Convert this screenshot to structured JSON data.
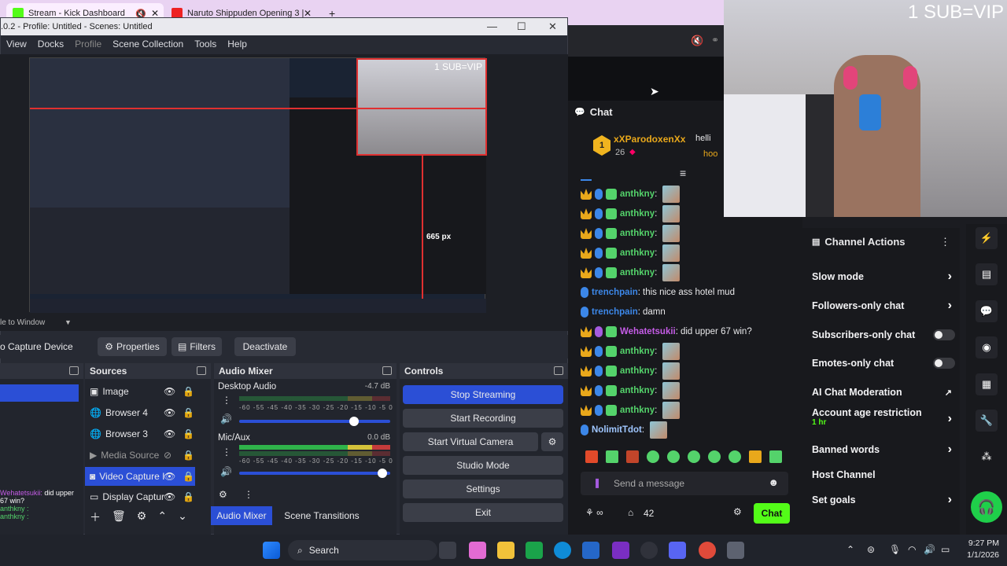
{
  "browser": {
    "tabs": [
      {
        "label": "Stream - Kick Dashboard"
      },
      {
        "label": "Naruto Shippuden Opening 3 |"
      }
    ],
    "new_tab": "+"
  },
  "obs": {
    "title": ".0.2 - Profile: Untitled - Scenes: Untitled",
    "menu": [
      "View",
      "Docks",
      "Profile",
      "Scene Collection",
      "Tools",
      "Help"
    ],
    "scale_label": "le to Window",
    "source_toolbar": {
      "selected_source": "o Capture Device",
      "properties": "Properties",
      "filters": "Filters",
      "deactivate": "Deactivate"
    },
    "sources": {
      "header": "Sources",
      "items": [
        {
          "label": "Image"
        },
        {
          "label": "Browser 4"
        },
        {
          "label": "Browser 3"
        },
        {
          "label": "Media Source"
        },
        {
          "label": "Video Capture I"
        },
        {
          "label": "Display Captur"
        }
      ]
    },
    "audio_mixer": {
      "header": "Audio Mixer",
      "channels": [
        {
          "name": "Desktop Audio",
          "db": "-4.7 dB"
        },
        {
          "name": "Mic/Aux",
          "db": "0.0 dB"
        }
      ],
      "scale": "-60 -55 -45 -40 -35 -30 -25 -20 -15 -10 -5 0"
    },
    "controls": {
      "header": "Controls",
      "buttons": [
        "Stop Streaming",
        "Start Recording",
        "Start Virtual Camera",
        "Studio Mode",
        "Settings",
        "Exit"
      ]
    },
    "bottom_tabs": [
      "Audio Mixer",
      "Scene Transitions"
    ],
    "preview_overlay": "1 SUB=VIP",
    "preview_px": "665 px"
  },
  "overlay_chat": [
    {
      "user": "Wehatetsukii",
      "msg": "did upper 67 win?"
    },
    {
      "user": "anthkny",
      "msg": ""
    },
    {
      "user": "anthkny",
      "msg": ""
    }
  ],
  "chat": {
    "header": "Chat",
    "pinned_user": "xXParodoxenXx",
    "pinned_level": "26",
    "pinned_rank": "1",
    "pinned_right_1": "helli",
    "pinned_right_2": "hoo",
    "messages": [
      {
        "user": "anthkny",
        "text": "",
        "color": "#54d36b"
      },
      {
        "user": "anthkny",
        "text": "",
        "color": "#54d36b"
      },
      {
        "user": "anthkny",
        "text": "",
        "color": "#54d36b"
      },
      {
        "user": "anthkny",
        "text": "",
        "color": "#54d36b"
      },
      {
        "user": "anthkny",
        "text": "",
        "color": "#54d36b"
      },
      {
        "user": "trenchpain",
        "text": "this nice ass hotel mud",
        "color": "#3c87e8"
      },
      {
        "user": "trenchpain",
        "text": "damn",
        "color": "#3c87e8"
      },
      {
        "user": "Wehatetsukii",
        "text": "did upper 67 win?",
        "color": "#c45ce6"
      },
      {
        "user": "anthkny",
        "text": "",
        "color": "#54d36b"
      },
      {
        "user": "anthkny",
        "text": "",
        "color": "#54d36b"
      },
      {
        "user": "anthkny",
        "text": "",
        "color": "#54d36b"
      },
      {
        "user": "anthkny",
        "text": "",
        "color": "#54d36b"
      },
      {
        "user": "NolimitTdot",
        "text": "",
        "color": "#9fc6ff"
      }
    ],
    "input_placeholder": "Send a message",
    "viewers": "42",
    "chat_button": "Chat"
  },
  "webcam_overlay": "1 SUB=VIP",
  "channel_actions": {
    "header": "Channel Actions",
    "items": [
      {
        "label": "Slow mode",
        "control": "chevron"
      },
      {
        "label": "Followers-only chat",
        "control": "chevron"
      },
      {
        "label": "Subscribers-only chat",
        "control": "toggle"
      },
      {
        "label": "Emotes-only chat",
        "control": "toggle"
      },
      {
        "label": "AI Chat Moderation",
        "control": "external"
      },
      {
        "label": "Account age restriction",
        "sub": "1 hr",
        "control": "chevron"
      },
      {
        "label": "Banned words",
        "control": "chevron"
      },
      {
        "label": "Host Channel",
        "control": "none"
      },
      {
        "label": "Set goals",
        "control": "chevron"
      }
    ]
  },
  "taskbar": {
    "search": "Search",
    "time": "9:27 PM",
    "date": "1/1/2026"
  },
  "colors": {
    "kick_green": "#53fc18",
    "obs_blue": "#2b4fd6"
  }
}
